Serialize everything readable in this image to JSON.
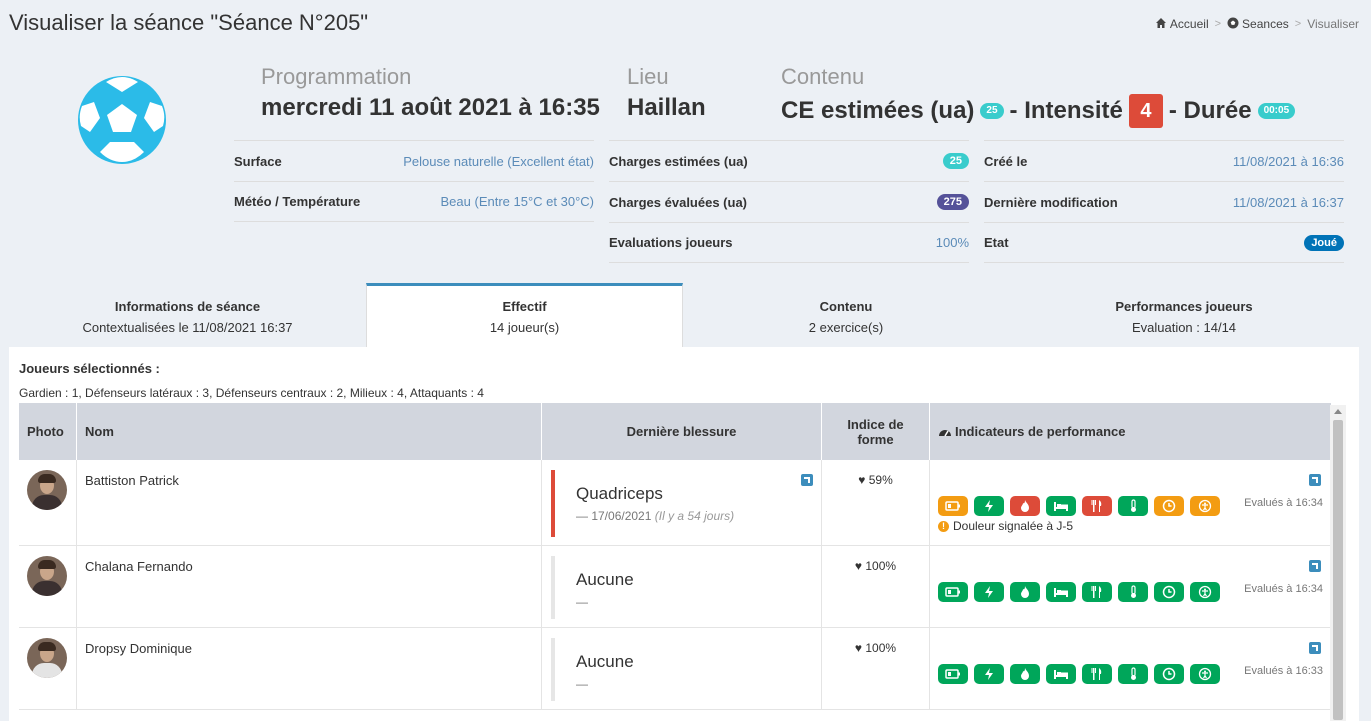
{
  "page": {
    "title": "Visualiser la séance \"Séance N°205\""
  },
  "breadcrumb": {
    "home": "Accueil",
    "seances": "Seances",
    "current": "Visualiser"
  },
  "summary": {
    "programmation_label": "Programmation",
    "programmation_value": "mercredi 11 août 2021 à 16:35",
    "lieu_label": "Lieu",
    "lieu_value": "Haillan",
    "contenu_label": "Contenu",
    "ce_label": "CE estimées (ua)",
    "ce_badge": "25",
    "intensite_label": "- Intensité",
    "intensite_value": "4",
    "duree_label": "- Durée",
    "duree_badge": "00:05"
  },
  "info_left": [
    {
      "key": "Surface",
      "value": "Pelouse naturelle (Excellent état)"
    },
    {
      "key": "Météo / Température",
      "value": "Beau (Entre 15°C et 30°C)"
    }
  ],
  "info_mid": [
    {
      "key": "Charges estimées (ua)",
      "value": "25"
    },
    {
      "key": "Charges évaluées (ua)",
      "value": "275"
    },
    {
      "key": "Evaluations joueurs",
      "value": "100%"
    }
  ],
  "info_right": [
    {
      "key": "Créé le",
      "value": "11/08/2021 à 16:36"
    },
    {
      "key": "Dernière modification",
      "value": "11/08/2021 à 16:37"
    },
    {
      "key": "Etat",
      "value": "Joué"
    }
  ],
  "tabs": [
    {
      "title": "Informations de séance",
      "sub": "Contextualisées le 11/08/2021 16:37"
    },
    {
      "title": "Effectif",
      "sub": "14 joueur(s)"
    },
    {
      "title": "Contenu",
      "sub": "2 exercice(s)"
    },
    {
      "title": "Performances joueurs",
      "sub": "Evaluation : 14/14"
    }
  ],
  "effectif": {
    "title": "Joueurs sélectionnés :",
    "summary": "Gardien : 1, Défenseurs latéraux : 3, Défenseurs centraux : 2, Milieux : 4, Attaquants : 4",
    "headers": {
      "photo": "Photo",
      "nom": "Nom",
      "blessure": "Dernière blessure",
      "forme": "Indice de forme",
      "indicateurs": "Indicateurs de performance"
    },
    "players": [
      {
        "name": "Battiston Patrick",
        "injury": "Quadriceps",
        "injury_date": "— 17/06/2021",
        "injury_ago": "(Il y a 54 jours)",
        "forme": "59%",
        "evaluated": "Evalués à 16:34",
        "warning": "Douleur signalée à J-5"
      },
      {
        "name": "Chalana Fernando",
        "injury": "Aucune",
        "injury_date": "—",
        "injury_ago": "",
        "forme": "100%",
        "evaluated": "Evalués à 16:34",
        "warning": ""
      },
      {
        "name": "Dropsy Dominique",
        "injury": "Aucune",
        "injury_date": "—",
        "injury_ago": "",
        "forme": "100%",
        "evaluated": "Evalués à 16:33",
        "warning": ""
      }
    ]
  },
  "colors": {
    "green": "#00a65a",
    "orange": "#f39c12",
    "red": "#dd4b39",
    "teal": "#39cccc",
    "blue": "#3c8dbc"
  }
}
